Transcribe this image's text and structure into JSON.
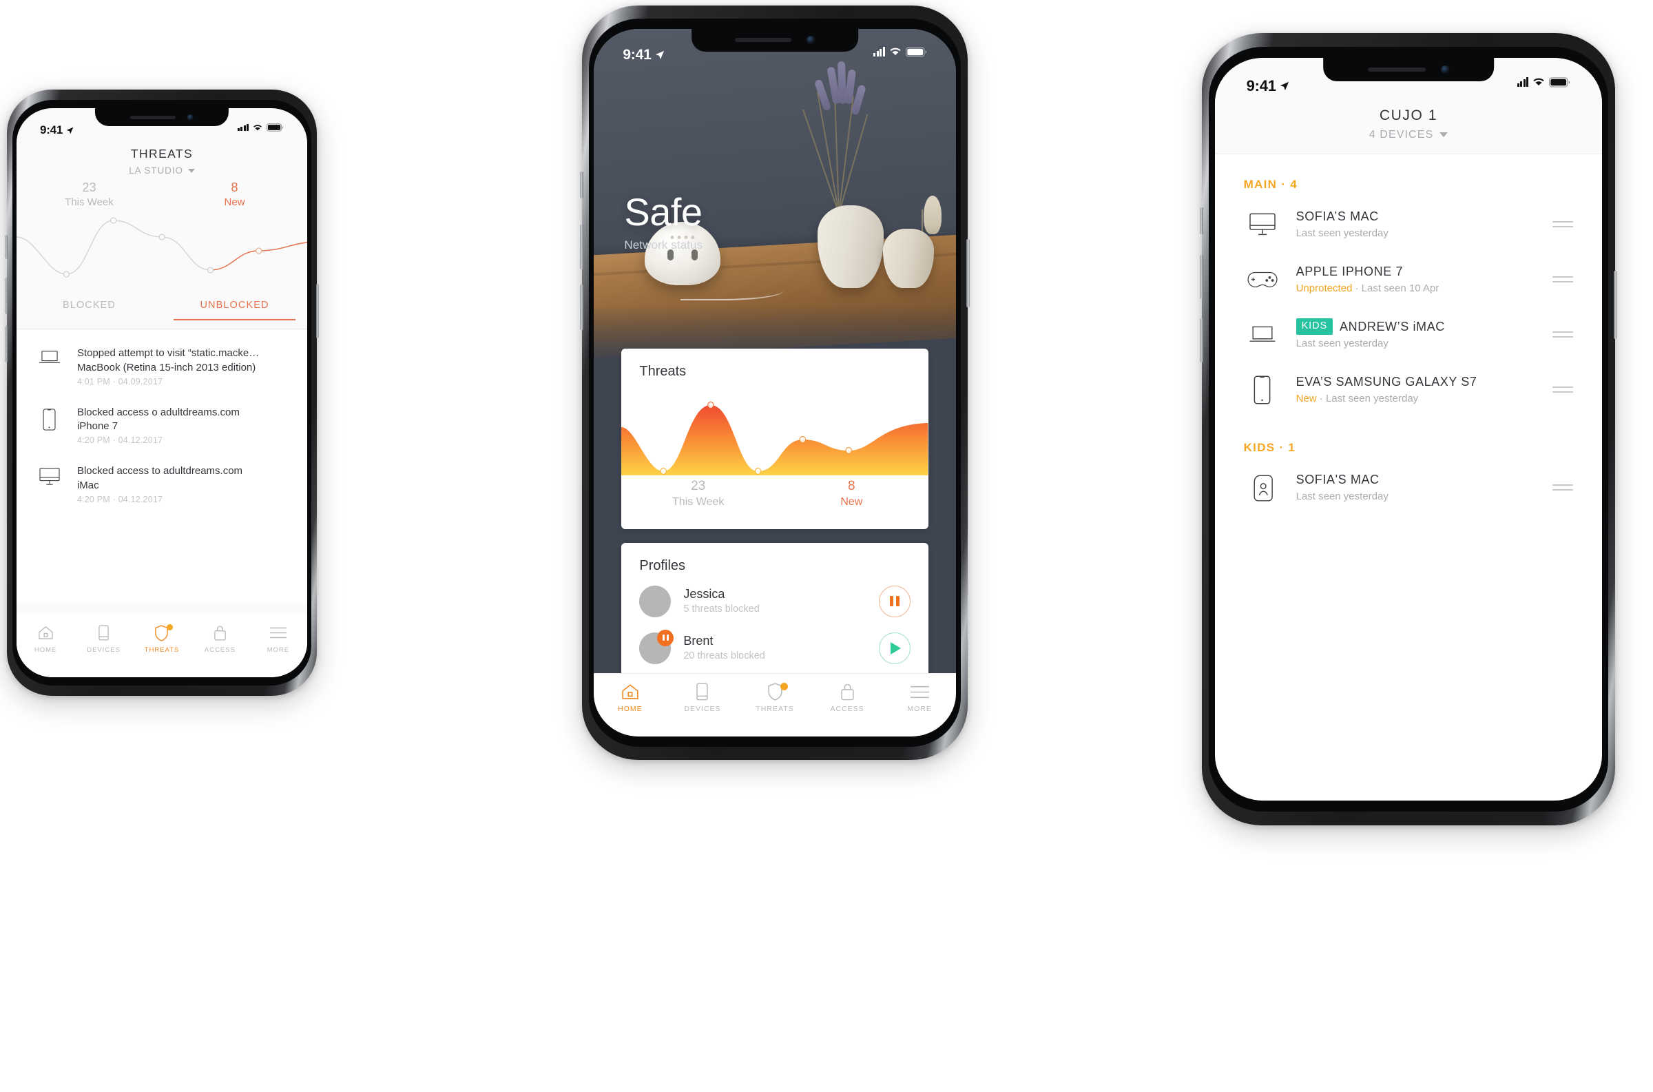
{
  "phone_left": {
    "status": {
      "time": "9:41",
      "location_icon": "location-arrow-icon"
    },
    "header": {
      "title": "THREATS",
      "subtitle": "LA STUDIO"
    },
    "stats": {
      "count": "23",
      "count_label": "This Week",
      "new_count": "8",
      "new_label": "New"
    },
    "tabs": [
      {
        "label": "BLOCKED",
        "active": false
      },
      {
        "label": "UNBLOCKED",
        "active": true
      }
    ],
    "threats": [
      {
        "icon": "macbook-icon",
        "line1": "Stopped attempt to visit “static.macke…",
        "line2": "MacBook (Retina 15-inch 2013 edition)",
        "time": "4:01  PM · 04.09.2017"
      },
      {
        "icon": "iphone-icon",
        "line1": "Blocked access o adultdreams.com",
        "line2": "iPhone 7",
        "time": "4:20 PM · 04.12.2017"
      },
      {
        "icon": "imac-icon",
        "line1": "Blocked access to adultdreams.com",
        "line2": "iMac",
        "time": "4:20 PM · 04.12.2017"
      }
    ],
    "tabbar": [
      {
        "label": "HOME",
        "icon": "home-icon",
        "active": false,
        "badge": false
      },
      {
        "label": "DEVICES",
        "icon": "devices-icon",
        "active": false,
        "badge": false
      },
      {
        "label": "THREATS",
        "icon": "shield-icon",
        "active": true,
        "badge": true
      },
      {
        "label": "ACCESS",
        "icon": "lock-icon",
        "active": false,
        "badge": false
      },
      {
        "label": "MORE",
        "icon": "hamburger-icon",
        "active": false,
        "badge": false
      }
    ],
    "chart_data": {
      "type": "line",
      "title": "Threats",
      "x": [
        0,
        1,
        2,
        3,
        4,
        5,
        6
      ],
      "values": [
        62,
        22,
        86,
        62,
        18,
        42,
        38
      ],
      "point_indices": [
        1,
        2,
        4,
        5
      ],
      "line_color": "#cfd2d5",
      "accent_color": "#e8714a",
      "grid": false,
      "ylim": [
        0,
        100
      ]
    }
  },
  "phone_center": {
    "status": {
      "time": "9:41",
      "location_icon": "location-arrow-icon"
    },
    "hero": {
      "title": "Safe",
      "subtitle": "Network status"
    },
    "threats_card": {
      "title": "Threats",
      "count": "23",
      "count_label": "This Week",
      "new_count": "8",
      "new_label": "New"
    },
    "profiles_card": {
      "title": "Profiles",
      "items": [
        {
          "name": "Jessica",
          "sub": "5 threats blocked",
          "action": "pause",
          "paused_badge": false
        },
        {
          "name": "Brent",
          "sub": "20 threats blocked",
          "action": "play",
          "paused_badge": true
        }
      ]
    },
    "tabbar": [
      {
        "label": "HOME",
        "icon": "home-icon",
        "active": true,
        "badge": false
      },
      {
        "label": "DEVICES",
        "icon": "devices-icon",
        "active": false,
        "badge": false
      },
      {
        "label": "THREATS",
        "icon": "shield-icon",
        "active": false,
        "badge": true
      },
      {
        "label": "ACCESS",
        "icon": "lock-icon",
        "active": false,
        "badge": false
      },
      {
        "label": "MORE",
        "icon": "hamburger-icon",
        "active": false,
        "badge": false
      }
    ],
    "chart_data": {
      "type": "area",
      "title": "Threats",
      "x": [
        0,
        1,
        2,
        3,
        4,
        5,
        6
      ],
      "values": [
        58,
        8,
        96,
        8,
        46,
        32,
        56
      ],
      "point_indices": [
        1,
        2,
        3,
        4,
        5
      ],
      "gradient_from": "#f04b32",
      "gradient_to": "#fbc02d",
      "grid": false,
      "ylim": [
        0,
        100
      ],
      "summary": {
        "this_week": 23,
        "new": 8
      }
    }
  },
  "phone_right": {
    "status": {
      "time": "9:41",
      "location_icon": "location-arrow-icon"
    },
    "header": {
      "title": "CUJO 1",
      "subtitle": "4 DEVICES"
    },
    "groups": [
      {
        "label": "MAIN · 4",
        "devices": [
          {
            "icon": "imac-icon",
            "tag": "",
            "name": "SOFIA’S MAC",
            "status_warn": "",
            "status": "Last seen yesterday"
          },
          {
            "icon": "gamepad-icon",
            "tag": "",
            "name": "APPLE IPHONE 7",
            "status_warn": "Unprotected",
            "status": " · Last seen 10 Apr"
          },
          {
            "icon": "macbook-icon",
            "tag": "KIDS",
            "name": "ANDREW’S iMAC",
            "status_warn": "",
            "status": "Last seen yesterday"
          },
          {
            "icon": "iphone-icon",
            "tag": "",
            "name": "EVA’S SAMSUNG GALAXY S7",
            "status_warn": "New",
            "status": " · Last seen yesterday"
          }
        ]
      },
      {
        "label": "KIDS · 1",
        "devices": [
          {
            "icon": "kid-phone-icon",
            "tag": "",
            "name": "SOFIA'S MAC",
            "status_warn": "",
            "status": "Last seen yesterday"
          }
        ]
      }
    ]
  },
  "colors": {
    "accent_orange": "#f5a623",
    "accent_red": "#e8714a",
    "kids_teal": "#27c2a0",
    "play_green": "#2ecc94",
    "dark_navy": "#3e4450"
  }
}
